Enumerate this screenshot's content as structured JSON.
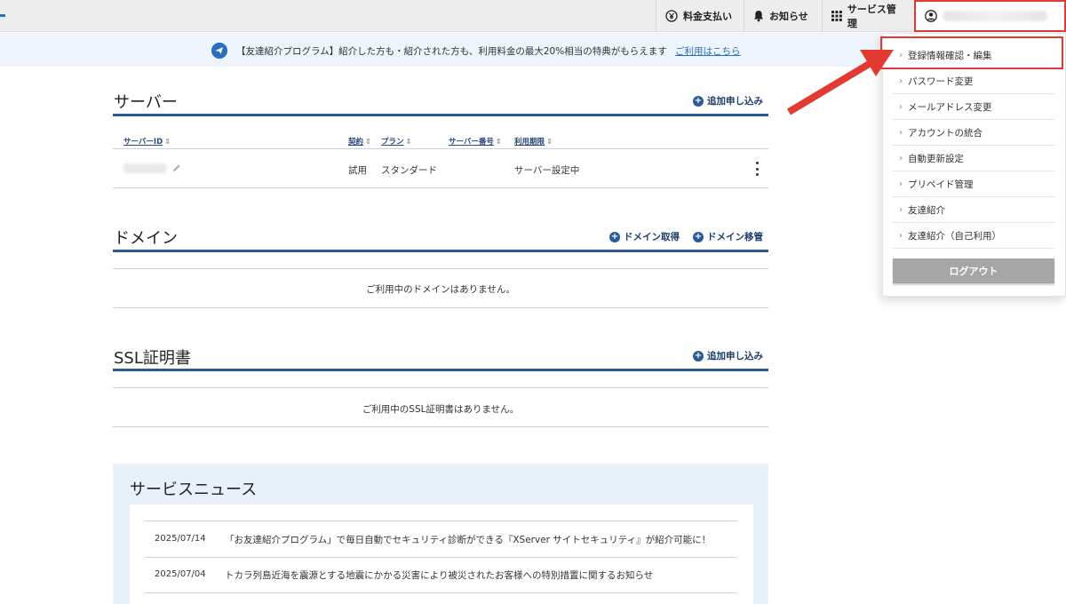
{
  "header": {
    "payment_label": "料金支払い",
    "news_label": "お知らせ",
    "service_label": "サービス管理"
  },
  "banner": {
    "text": "【友達紹介プログラム】紹介した方も・紹介された方も、利用料金の最大20%相当の特典がもらえます",
    "link": "ご利用はこちら"
  },
  "server": {
    "title": "サーバー",
    "action": "追加申し込み",
    "columns": [
      "サーバーID",
      "契約",
      "プラン",
      "サーバー番号",
      "利用期限"
    ],
    "rows": [
      {
        "contract": "試用",
        "plan": "スタンダード",
        "expiry": "サーバー設定中"
      }
    ]
  },
  "domain": {
    "title": "ドメイン",
    "action_get": "ドメイン取得",
    "action_transfer": "ドメイン移管",
    "empty": "ご利用中のドメインはありません。"
  },
  "ssl": {
    "title": "SSL証明書",
    "action": "追加申し込み",
    "empty": "ご利用中のSSL証明書はありません。"
  },
  "news": {
    "title": "サービスニュース",
    "items": [
      {
        "date": "2025/07/14",
        "text": "「お友達紹介プログラム」で毎日自動でセキュリティ診断ができる『XServer サイトセキュリティ』が紹介可能に！"
      },
      {
        "date": "2025/07/04",
        "text": "トカラ列島近海を震源とする地震にかかる災害により被災されたお客様への特別措置に関するお知らせ"
      }
    ]
  },
  "account_menu": {
    "items": [
      "登録情報確認・編集",
      "パスワード変更",
      "メールアドレス変更",
      "アカウントの統合",
      "自動更新設定",
      "プリペイド管理",
      "友達紹介",
      "友達紹介（自己利用）"
    ],
    "logout": "ログアウト"
  },
  "colors": {
    "accent": "#2a5a96",
    "highlight": "#e23a33"
  }
}
